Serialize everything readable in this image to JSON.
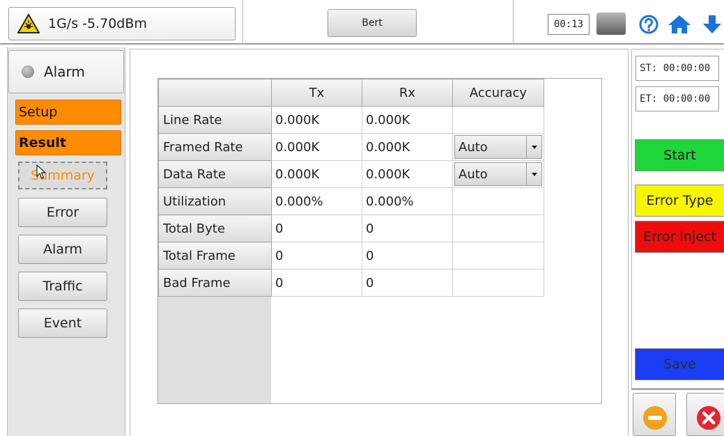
{
  "header": {
    "signal_text": "1G/s -5.70dBm",
    "mode_label": "Bert",
    "clock": "00:13",
    "icons": [
      "laser-warning-icon",
      "battery-icon",
      "help-icon",
      "home-icon",
      "down-arrow-icon"
    ]
  },
  "sidebar": {
    "alarm_label": "Alarm",
    "setup_label": "Setup",
    "result_label": "Result",
    "summary_label": "Summary",
    "items": [
      {
        "label": "Error"
      },
      {
        "label": "Alarm"
      },
      {
        "label": "Traffic"
      },
      {
        "label": "Event"
      }
    ]
  },
  "table": {
    "columns": [
      "",
      "Tx",
      "Rx",
      "Accuracy"
    ],
    "rows": [
      {
        "label": "Line Rate",
        "tx": "0.000K",
        "rx": "0.000K",
        "accuracy": ""
      },
      {
        "label": "Framed Rate",
        "tx": "0.000K",
        "rx": "0.000K",
        "accuracy": "Auto"
      },
      {
        "label": "Data Rate",
        "tx": "0.000K",
        "rx": "0.000K",
        "accuracy": "Auto"
      },
      {
        "label": "Utilization",
        "tx": "0.000%",
        "rx": "0.000%",
        "accuracy": ""
      },
      {
        "label": "Total Byte",
        "tx": "0",
        "rx": "0",
        "accuracy": ""
      },
      {
        "label": "Total Frame",
        "tx": "0",
        "rx": "0",
        "accuracy": ""
      },
      {
        "label": "Bad Frame",
        "tx": "0",
        "rx": "0",
        "accuracy": ""
      }
    ]
  },
  "right_panel": {
    "start_time": "ST: 00:00:00",
    "end_time": "ET: 00:00:00",
    "start_label": "Start",
    "error_type_label": "Error Type",
    "error_inject_label": "Error Inject",
    "save_label": "Save"
  },
  "colors": {
    "tab_orange": "#ff8c00",
    "start_green": "#1fd63a",
    "error_type_yellow": "#f6f600",
    "error_inject_red": "#ee0d0d",
    "save_blue": "#1c3cf5"
  }
}
